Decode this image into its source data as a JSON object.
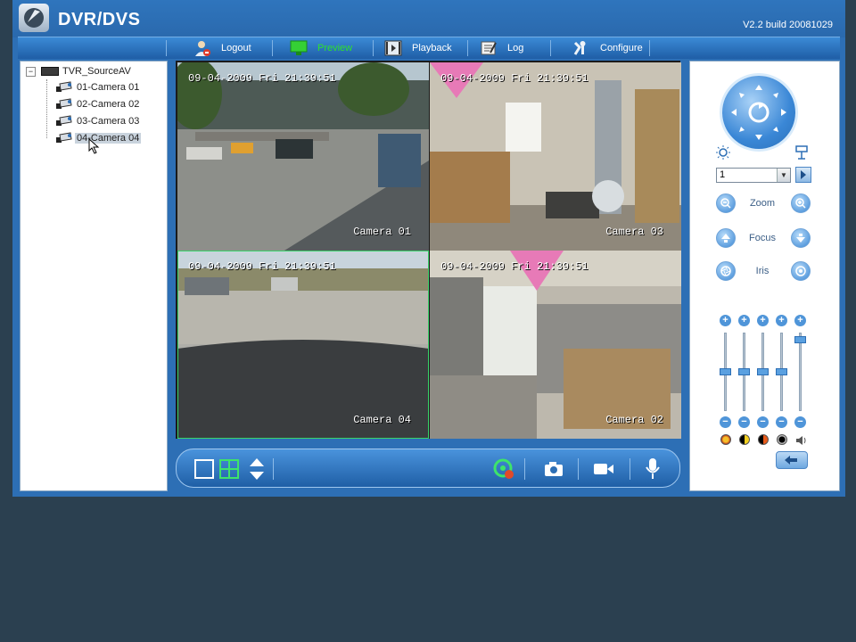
{
  "app": {
    "title": "DVR/DVS",
    "version": "V2.2  build 20081029"
  },
  "menu": [
    {
      "label": "Logout",
      "icon": "logout-icon"
    },
    {
      "label": "Preview",
      "icon": "preview-icon",
      "active": true
    },
    {
      "label": "Playback",
      "icon": "playback-icon"
    },
    {
      "label": "Log",
      "icon": "log-icon"
    },
    {
      "label": "Configure",
      "icon": "configure-icon"
    }
  ],
  "tree": {
    "root": "TVR_SourceAV",
    "items": [
      {
        "label": "01-Camera 01"
      },
      {
        "label": "02-Camera 02"
      },
      {
        "label": "03-Camera 03"
      },
      {
        "label": "04-Camera 04",
        "selected": true
      }
    ]
  },
  "views": [
    {
      "timestamp": "09-04-2009 Fri 21:39:51",
      "camera": "Camera 01"
    },
    {
      "timestamp": "09-04-2009 Fri 21:39:51",
      "camera": "Camera 03"
    },
    {
      "timestamp": "09-04-2009 Fri 21:39:51",
      "camera": "Camera 04",
      "selected": true
    },
    {
      "timestamp": "09-04-2009 Fri 21:39:51",
      "camera": "Camera 02"
    }
  ],
  "ptz": {
    "preset_value": "1",
    "zoom_label": "Zoom",
    "focus_label": "Focus",
    "iris_label": "Iris",
    "sliders": [
      {
        "name": "brightness",
        "level": 0.5
      },
      {
        "name": "contrast",
        "level": 0.5
      },
      {
        "name": "saturation",
        "level": 0.5
      },
      {
        "name": "hue",
        "level": 0.5
      },
      {
        "name": "volume",
        "level": 0.95
      }
    ]
  },
  "colors": {
    "accent": "#2d6fb5",
    "active_menu": "#2ee02e",
    "selected_view": "#39d46a"
  }
}
